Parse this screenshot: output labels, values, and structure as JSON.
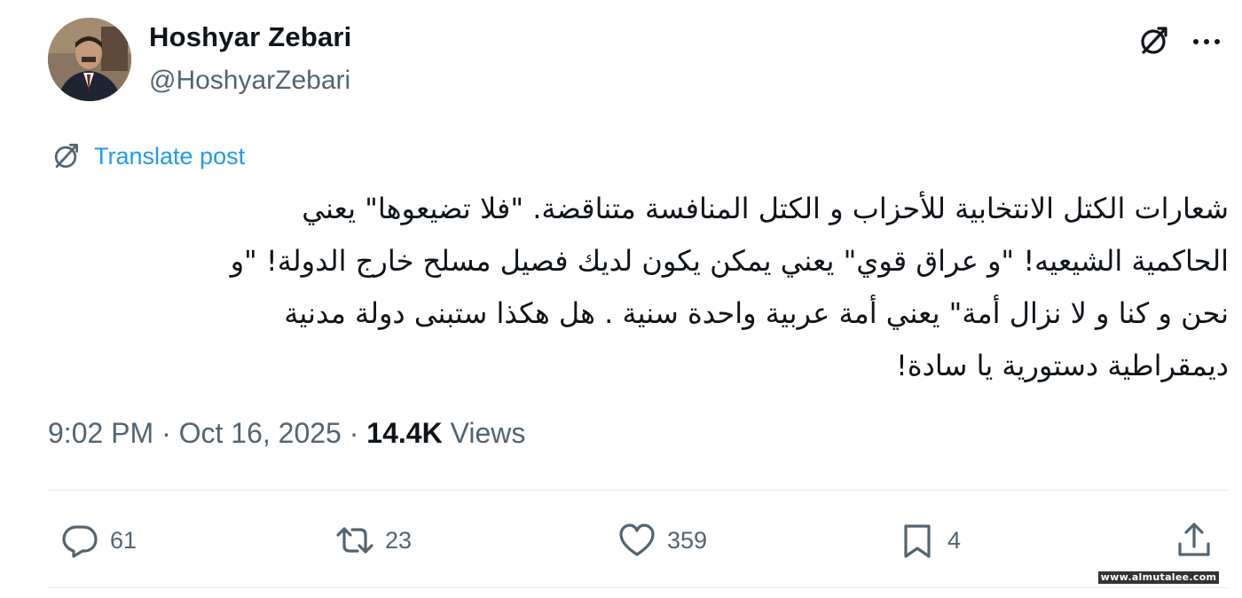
{
  "author": {
    "name": "Hoshyar Zebari",
    "handle": "@HoshyarZebari"
  },
  "translate": {
    "label": "Translate post"
  },
  "tweet": {
    "lines": [
      "شعارات الكتل الانتخابية للأحزاب و الكتل المنافسة متناقضة. \"فلا تضيعوها\" يعني",
      "الحاكمية الشيعيه! \"و عراق قوي\" يعني يمكن يكون لديك فصيل مسلح خارج الدولة! \"و",
      "نحن و كنا و لا نزال أمة\" يعني أمة عربية واحدة سنية . هل هكذا ستبنى دولة مدنية",
      "ديمقراطية دستورية يا سادة!"
    ]
  },
  "meta": {
    "time": "9:02 PM",
    "date": "Oct 16, 2025",
    "separator": "·",
    "views_count": "14.4K",
    "views_label": "Views"
  },
  "actions": {
    "replies": "61",
    "reposts": "23",
    "likes": "359",
    "bookmarks": "4"
  },
  "icons": {
    "grok": "grok-icon",
    "more": "more-icon",
    "translate": "grok-translate-icon",
    "reply": "reply-icon",
    "repost": "repost-icon",
    "like": "heart-icon",
    "bookmark": "bookmark-icon",
    "share": "share-icon"
  },
  "colors": {
    "link": "#1d9bf0",
    "secondary": "#536471",
    "text": "#0f1419",
    "divider": "#e6ecf0"
  },
  "watermark": "www.almutalee.com"
}
